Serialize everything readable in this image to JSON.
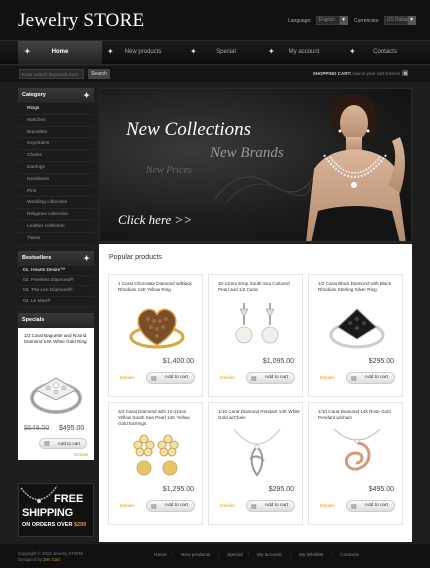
{
  "header": {
    "logo": "Jewelry STORE",
    "language_label": "Language:",
    "language_value": "English",
    "currencies_label": "Currencies:",
    "currencies_value": "US Dollar"
  },
  "nav": [
    "Home",
    "New products",
    "Special",
    "My account",
    "Contacts"
  ],
  "search": {
    "placeholder": "Enter search keywords here",
    "button": "Search"
  },
  "cart": {
    "label": "SHOPPING CART:",
    "text": "now in your cart 0 items"
  },
  "sidebar": {
    "category_title": "Category",
    "categories": [
      "Rings",
      "Watches",
      "Bracelets",
      "Keychains",
      "Chains",
      "Earrings",
      "Necklaces",
      "Pins",
      "Wedding collection",
      "Religious collection",
      "Leather collection",
      "Tiaras"
    ],
    "bestsellers_title": "Bestsellers",
    "bestsellers": [
      "01. Hearts Desire™",
      "02. Peerless Diamond®",
      "03. The Leo Diamond®",
      "04. Le Man®"
    ],
    "specials_title": "Specials",
    "special": {
      "name": "1/2 Carat Baguette and Round Diamond 14K White Gold Ring",
      "old_price": "$549.00",
      "new_price": "$495.00",
      "cart": "Add to cart",
      "details": "Details"
    },
    "free_shipping": {
      "line1": "FREE",
      "line2": "SHIPPING",
      "line3_a": "ON ORDERS OVER",
      "line3_b": "$299"
    }
  },
  "hero": {
    "line1": "New Collections",
    "line2": "New Brands",
    "line3": "New Prices",
    "cta": "Click here >>"
  },
  "popular": {
    "title": "Popular products",
    "items": [
      {
        "name": "1 Carat Chocolate Diamond w/Black Rhodium 14K Yellow Ring",
        "price": "$1,400.00",
        "details": "Details",
        "cart": "Add to cart"
      },
      {
        "name": "10-11mm Drop South Sea Cultured Pearl and 1/2 Carat",
        "price": "$1,095.00",
        "details": "Details",
        "cart": "Add to cart"
      },
      {
        "name": "1/2 Carat Black Diamond with Black Rhodium Sterling Silver Ring",
        "price": "$295.00",
        "details": "Details",
        "cart": "Add to cart"
      },
      {
        "name": "3/4 Carat Diamond with 10-11mm Yellow South Sea Pearl 14K Yellow Gold Earrings",
        "price": "$1,295.00",
        "details": "Details",
        "cart": "Add to cart"
      },
      {
        "name": "1/10 Carat Diamond Pendant 14K White Gold w/Chain",
        "price": "$295.00",
        "details": "Details",
        "cart": "Add to cart"
      },
      {
        "name": "1/10 Carat Diamond 14k Rose Gold Pendant w/chain",
        "price": "$495.00",
        "details": "Details",
        "cart": "Add to cart"
      }
    ]
  },
  "footer": {
    "copy1": "Copyright © 2010 Jewelry STORE",
    "copy2_a": "Designed by",
    "copy2_b": "Zen Cart",
    "links": [
      "Home",
      "New products",
      "Special",
      "My account",
      "My Wishlist",
      "Contacts"
    ]
  }
}
